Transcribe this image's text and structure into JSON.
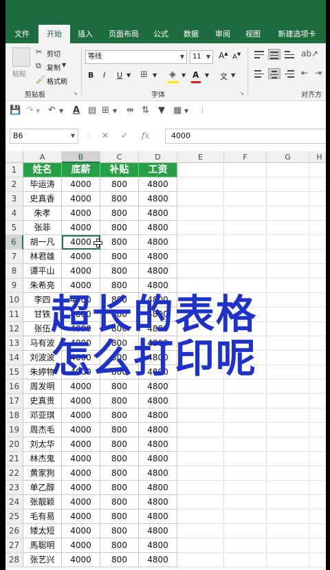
{
  "ribbon": {
    "tabs": [
      "文件",
      "开始",
      "插入",
      "页面布局",
      "公式",
      "数据",
      "审阅",
      "视图",
      "新建选项卡"
    ],
    "active_tab": "开始",
    "clipboard": {
      "paste": "粘贴",
      "cut": "剪切",
      "copy": "复制",
      "format_painter": "格式刷",
      "group_label": "剪贴板"
    },
    "font": {
      "name": "等线",
      "size": "11",
      "bold": "B",
      "italic": "I",
      "underline": "U",
      "grow": "A",
      "shrink": "A",
      "group_label": "字体"
    },
    "alignment": {
      "group_label": "对齐方"
    }
  },
  "formula_bar": {
    "name_box": "B6",
    "fx": "fx",
    "value": "4000"
  },
  "sheet": {
    "columns": [
      "A",
      "B",
      "C",
      "D",
      "E",
      "F",
      "G",
      "H"
    ],
    "rows": [
      [
        "姓名",
        "底薪",
        "补贴",
        "工资"
      ],
      [
        "毕运涛",
        "4000",
        "800",
        "4800"
      ],
      [
        "史真香",
        "4000",
        "800",
        "4800"
      ],
      [
        "朱孝",
        "4000",
        "800",
        "4800"
      ],
      [
        "张菲",
        "4000",
        "800",
        "4800"
      ],
      [
        "胡一凡",
        "4000",
        "800",
        "4800"
      ],
      [
        "林君雄",
        "4000",
        "800",
        "4800"
      ],
      [
        "谭平山",
        "4000",
        "800",
        "4800"
      ],
      [
        "朱希亮",
        "4000",
        "800",
        "4800"
      ],
      [
        "李四",
        "4000",
        "800",
        "4800"
      ],
      [
        "甘铁",
        "4000",
        "800",
        "4800"
      ],
      [
        "张伍",
        "4000",
        "800",
        "4800"
      ],
      [
        "马有波",
        "4000",
        "800",
        "4800"
      ],
      [
        "刘波波",
        "4000",
        "800",
        "4800"
      ],
      [
        "朱婷物",
        "4000",
        "800",
        "4800"
      ],
      [
        "周发明",
        "4000",
        "800",
        "4800"
      ],
      [
        "史真贵",
        "4000",
        "800",
        "4800"
      ],
      [
        "邓亚琪",
        "4000",
        "800",
        "4800"
      ],
      [
        "周杰毛",
        "4000",
        "800",
        "4800"
      ],
      [
        "刘太华",
        "4000",
        "800",
        "4800"
      ],
      [
        "林杰鬼",
        "4000",
        "800",
        "4800"
      ],
      [
        "黄家狗",
        "4000",
        "800",
        "4800"
      ],
      [
        "单乙醇",
        "4000",
        "800",
        "4800"
      ],
      [
        "张靓颖",
        "4000",
        "800",
        "4800"
      ],
      [
        "毛有易",
        "4000",
        "800",
        "4800"
      ],
      [
        "矮太短",
        "4000",
        "800",
        "4800"
      ],
      [
        "馬聡明",
        "4000",
        "800",
        "4800"
      ],
      [
        "张艺兴",
        "4000",
        "800",
        "4800"
      ]
    ],
    "selected_cell": "B6",
    "header_color": "#27a047"
  },
  "overlay": {
    "line1": "超长的表格",
    "line2": "怎么打印呢",
    "color": "#1f32c8"
  },
  "colors": {
    "brand": "#217346",
    "tab_bar": "#1e6b40"
  }
}
